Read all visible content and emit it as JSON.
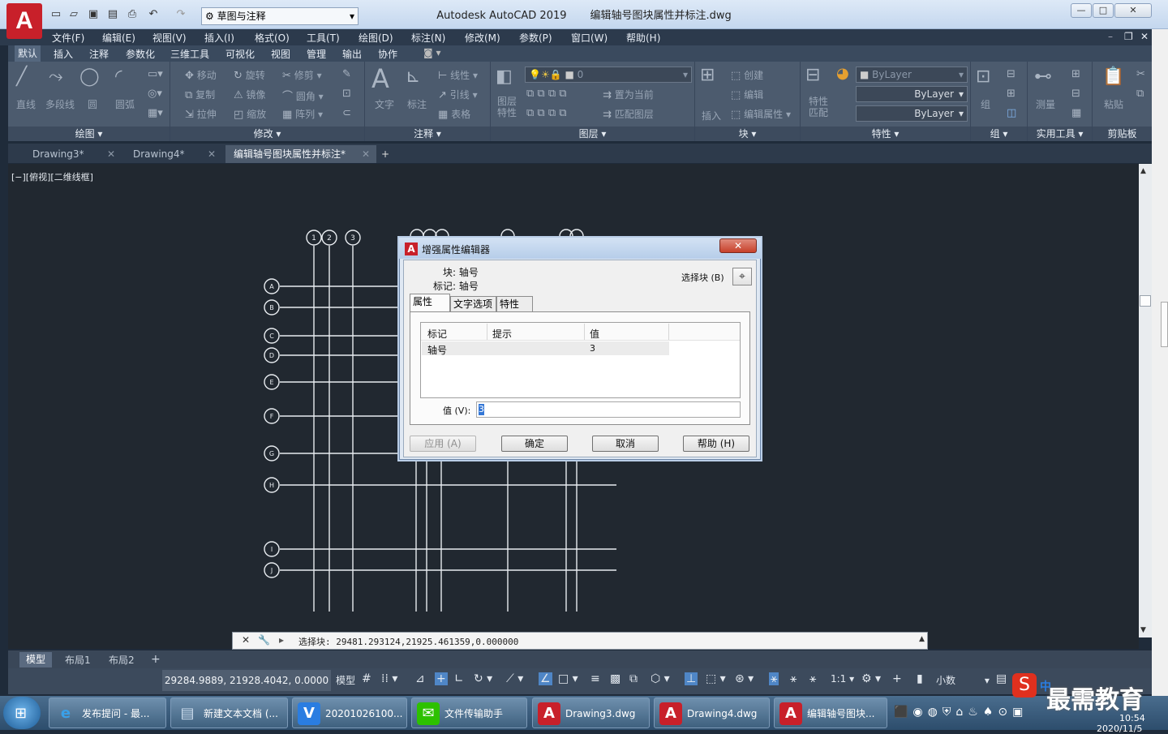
{
  "window": {
    "title": "Autodesk AutoCAD 2019       编辑轴号图块属性并标注.dwg",
    "app_logo": "A",
    "workspace": "草图与注释",
    "minimize": "—",
    "restore": "□",
    "close": "✕"
  },
  "menubar": [
    "文件(F)",
    "编辑(E)",
    "视图(V)",
    "插入(I)",
    "格式(O)",
    "工具(T)",
    "绘图(D)",
    "标注(N)",
    "修改(M)",
    "参数(P)",
    "窗口(W)",
    "帮助(H)"
  ],
  "ribbon_tabs": [
    "默认",
    "插入",
    "注释",
    "参数化",
    "三维工具",
    "可视化",
    "视图",
    "管理",
    "输出",
    "协作"
  ],
  "ribbon": {
    "draw": {
      "title": "绘图",
      "line": "直线",
      "polyline": "多段线",
      "circle": "圆",
      "arc": "圆弧"
    },
    "modify": {
      "title": "修改",
      "move": "移动",
      "rotate": "旋转",
      "trim": "修剪",
      "copy": "复制",
      "mirror": "镜像",
      "fillet": "圆角",
      "stretch": "拉伸",
      "scale": "缩放",
      "array": "阵列"
    },
    "annotation": {
      "title": "注释",
      "text": "文字",
      "dimension": "标注",
      "linear": "线性",
      "leader": "引线",
      "table": "表格"
    },
    "layers": {
      "title": "图层",
      "layer_props": "图层\n特性",
      "current_layer": "0",
      "set_current": "置为当前",
      "match_layer": "匹配图层"
    },
    "block": {
      "title": "块",
      "insert": "插入",
      "create": "创建",
      "edit": "编辑",
      "edit_attr": "编辑属性"
    },
    "properties": {
      "title": "特性",
      "match": "特性\n匹配",
      "color": "ByLayer",
      "linetype": "ByLayer",
      "lineweight": "ByLayer"
    },
    "groups": {
      "title": "组",
      "group": "组"
    },
    "utilities": {
      "title": "实用工具",
      "measure": "测量"
    },
    "clipboard": {
      "title": "剪贴板",
      "paste": "粘贴"
    }
  },
  "file_tabs": [
    {
      "label": "Drawing3*"
    },
    {
      "label": "Drawing4*"
    },
    {
      "label": "编辑轴号图块属性并标注*"
    }
  ],
  "viewport_label": "[−][俯视][二维线框]",
  "grid_bubbles": {
    "columns": [
      "1",
      "2",
      "3"
    ],
    "rows": [
      "A",
      "B",
      "C",
      "D",
      "E",
      "F",
      "G",
      "H",
      "I",
      "J"
    ]
  },
  "dialog": {
    "title": "增强属性编辑器",
    "close": "✕",
    "block_label": "块: 轴号",
    "tag_label": "标记: 轴号",
    "select_block": "选择块 (B)",
    "tabs": [
      "属性",
      "文字选项",
      "特性"
    ],
    "columns": [
      "标记",
      "提示",
      "值"
    ],
    "rows": [
      {
        "tag": "轴号",
        "prompt": "",
        "value": "3"
      }
    ],
    "value_label": "值 (V):",
    "value": "3",
    "buttons": {
      "apply": "应用 (A)",
      "ok": "确定",
      "cancel": "取消",
      "help": "帮助 (H)"
    }
  },
  "command_line": {
    "text": "选择块: 29481.293124,21925.461359,0.000000"
  },
  "layout_tabs": [
    "模型",
    "布局1",
    "布局2"
  ],
  "status": {
    "coords": "29284.9889, 21928.4042, 0.0000",
    "model": "模型",
    "scale": "1:1",
    "units": "小数"
  },
  "taskbar": {
    "items": [
      "发布提问 - 最...",
      "新建文本文档 (...",
      "20201026100...",
      "文件传输助手",
      "Drawing3.dwg",
      "Drawing4.dwg",
      "编辑轴号图块..."
    ],
    "time": "10:54",
    "date": "2020/11/5",
    "ime": "中"
  },
  "watermark": {
    "text": "最需教育",
    "icon": "S"
  }
}
